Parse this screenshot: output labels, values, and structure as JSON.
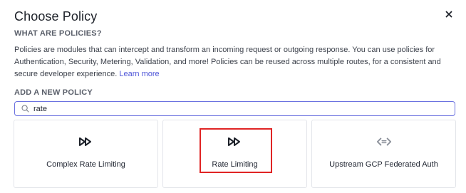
{
  "dialog": {
    "title": "Choose Policy",
    "what_are_label": "WHAT ARE POLICIES?",
    "description": "Policies are modules that can intercept and transform an incoming request or outgoing response. You can use policies for Authentication, Security, Metering, Validation, and more! Policies can be reused across multiple routes, for a consistent and secure developer experience.",
    "learn_more": "Learn more",
    "add_label": "ADD A NEW POLICY",
    "close_icon": "close-icon"
  },
  "search": {
    "value": "rate",
    "icon": "search-icon"
  },
  "policies": [
    {
      "label": "Complex Rate Limiting",
      "icon": "fast-forward-icon"
    },
    {
      "label": "Rate Limiting",
      "icon": "fast-forward-icon"
    },
    {
      "label": "Upstream GCP Federated Auth",
      "icon": "code-brackets-icon"
    }
  ],
  "colors": {
    "accent": "#4f56d8",
    "highlight": "#e02424",
    "search_border": "#6b72e0"
  }
}
